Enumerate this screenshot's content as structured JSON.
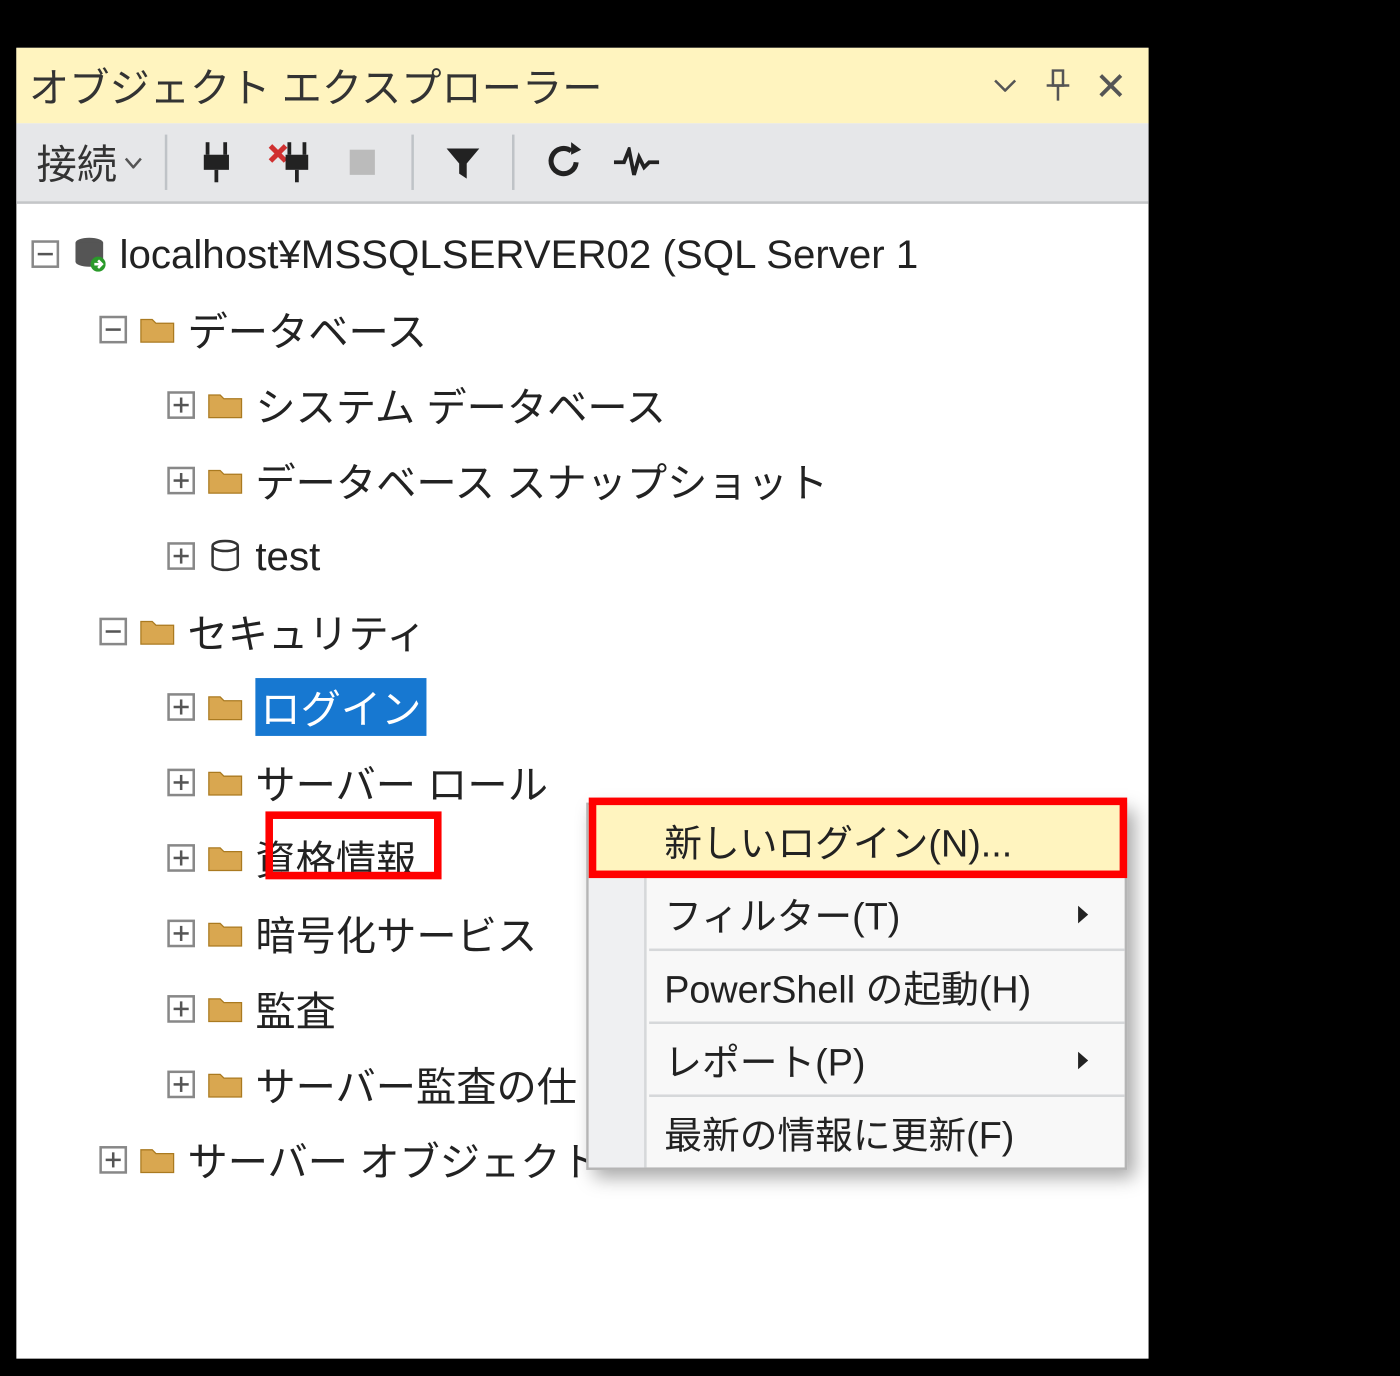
{
  "panel": {
    "title": "オブジェクト エクスプローラー"
  },
  "toolbar": {
    "connect_label": "接続"
  },
  "tree": {
    "server": "localhost¥MSSQLSERVER02 (SQL Server 1",
    "databases": "データベース",
    "sys_databases": "システム データベース",
    "db_snapshots": "データベース スナップショット",
    "db_test": "test",
    "security": "セキュリティ",
    "logins": "ログイン",
    "server_roles": "サーバー ロール",
    "credentials": "資格情報",
    "crypto_services": "暗号化サービス",
    "audits": "監査",
    "server_audits": "サーバー監査の仕",
    "server_objects": "サーバー オブジェクト"
  },
  "ctx": {
    "new_login": "新しいログイン(N)...",
    "filter": "フィルター(T)",
    "powershell": "PowerShell の起動(H)",
    "reports": "レポート(P)",
    "refresh": "最新の情報に更新(F)"
  }
}
